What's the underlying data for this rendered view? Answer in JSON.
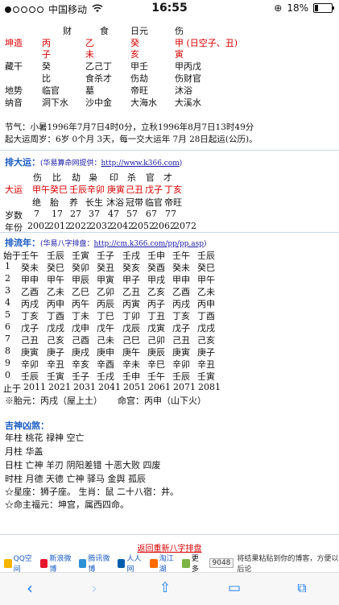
{
  "status": {
    "carrier": "中国移动",
    "time": "16:55",
    "battery": "18%",
    "battery_level": 0.18
  },
  "header": {
    "labels": [
      "财",
      "食",
      "日元",
      "伤"
    ]
  },
  "kunzao": {
    "label": "坤造",
    "gan": [
      "丙",
      "乙",
      "癸",
      "甲 (日空子、丑)"
    ],
    "zhi": [
      "子",
      "未",
      "亥",
      "寅"
    ]
  },
  "canggan": {
    "label": "藏干",
    "row1": [
      "癸",
      "乙己丁",
      "甲壬",
      "甲丙戊"
    ],
    "row2": [
      "比",
      "食杀才",
      "伤劫",
      "伤财官"
    ]
  },
  "dishi": {
    "label": "地势",
    "values": [
      "临官",
      "墓",
      "帝旺",
      "沐浴"
    ]
  },
  "nayin": {
    "label": "纳音",
    "values": [
      "洞下水",
      "沙中金",
      "大海水",
      "大溪水"
    ]
  },
  "jieqi": "节气：小暑1996年7月7日4时0分，立秋1996年8月7日13时49分",
  "qiyun": "起大运周岁：6岁 0个月 3天，每一交大运年 7月 28日起运(公历)。",
  "dayun": {
    "title": "排大运：",
    "provider": "(华易算命网提供：",
    "url": "http://www.k366.com",
    "close": ")",
    "ten_gods": [
      "伤",
      "比",
      "劫",
      "枭",
      "印",
      "杀",
      "官",
      "才"
    ],
    "label": "大运",
    "ganzhi": [
      "甲午",
      "癸巳",
      "壬辰",
      "辛卯",
      "庚寅",
      "己丑",
      "戊子",
      "丁亥"
    ],
    "stage": [
      "绝",
      "胎",
      "养",
      "长生",
      "沐浴",
      "冠带",
      "临官",
      "帝旺"
    ],
    "age_label": "岁数",
    "ages": [
      "7",
      "17",
      "27",
      "37",
      "47",
      "57",
      "67",
      "77"
    ],
    "year_label": "年份",
    "years": [
      "2002",
      "2012",
      "2022",
      "2032",
      "2042",
      "2052",
      "2062",
      "2072"
    ]
  },
  "liunian": {
    "title": "排流年：",
    "provider": "(华易八字排盘：",
    "url": "http://cm.k366.com/pp/pp.asp",
    "close": ")",
    "start_label": "始于",
    "start_row": [
      "壬午",
      "壬辰",
      "壬寅",
      "壬子",
      "壬戌",
      "壬申",
      "壬午",
      "壬辰"
    ],
    "rows": [
      {
        "n": "1",
        "c": [
          "癸未",
          "癸巳",
          "癸卯",
          "癸丑",
          "癸亥",
          "癸酉",
          "癸未",
          "癸巳"
        ]
      },
      {
        "n": "2",
        "c": [
          "甲申",
          "甲午",
          "甲辰",
          "甲寅",
          "甲子",
          "甲戌",
          "甲申",
          "甲午"
        ]
      },
      {
        "n": "3",
        "c": [
          "乙酉",
          "乙未",
          "乙巳",
          "乙卯",
          "乙丑",
          "乙亥",
          "乙酉",
          "乙未"
        ]
      },
      {
        "n": "4",
        "c": [
          "丙戌",
          "丙申",
          "丙午",
          "丙辰",
          "丙寅",
          "丙子",
          "丙戌",
          "丙申"
        ]
      },
      {
        "n": "5",
        "c": [
          "丁亥",
          "丁酉",
          "丁未",
          "丁巳",
          "丁卯",
          "丁丑",
          "丁亥",
          "丁酉"
        ]
      },
      {
        "n": "6",
        "c": [
          "戊子",
          "戊戌",
          "戊申",
          "戊午",
          "戊辰",
          "戊寅",
          "戊子",
          "戊戌"
        ]
      },
      {
        "n": "7",
        "c": [
          "己丑",
          "己亥",
          "己酉",
          "己未",
          "己巳",
          "己卯",
          "己丑",
          "己亥"
        ]
      },
      {
        "n": "8",
        "c": [
          "庚寅",
          "庚子",
          "庚戌",
          "庚申",
          "庚午",
          "庚辰",
          "庚寅",
          "庚子"
        ]
      },
      {
        "n": "9",
        "c": [
          "辛卯",
          "辛丑",
          "辛亥",
          "辛酉",
          "辛未",
          "辛巳",
          "辛卯",
          "辛丑"
        ]
      },
      {
        "n": "0",
        "c": [
          "壬辰",
          "壬寅",
          "壬子",
          "壬戌",
          "壬申",
          "壬午",
          "壬辰",
          "壬寅"
        ]
      }
    ],
    "end_label": "止于",
    "end_years": [
      "2011",
      "2021",
      "2031",
      "2041",
      "2051",
      "2061",
      "2071",
      "2081"
    ]
  },
  "taiyuan": "※胎元：丙戌（屋上土）",
  "minggong": "命宫：丙申（山下火）",
  "shensha": {
    "title": "吉神凶煞：",
    "lines": [
      "年柱 桃花 禄神 空亡",
      "月柱 华盖",
      "日柱 亡神 羊刃 阴阳差错 十恶大败 四废",
      "时柱 月德 天德 亡神 驿马 金舆 孤辰",
      "☆星座：狮子座。 生肖：鼠 二十八宿：井。",
      "☆命主福元：坤宫，属西四命。"
    ]
  },
  "footer": {
    "back_link": "返回重新八字排盘",
    "share": [
      "QQ空间",
      "新浪微博",
      "腾讯微博",
      "人人网",
      "淘江湖",
      "更多"
    ],
    "count": "9048",
    "note": "将结果粘贴到你的博客，方便以后论"
  },
  "colors": {
    "red": "#d80000",
    "blue": "#1a5bc4",
    "toolbar": "#1e7cf2"
  }
}
